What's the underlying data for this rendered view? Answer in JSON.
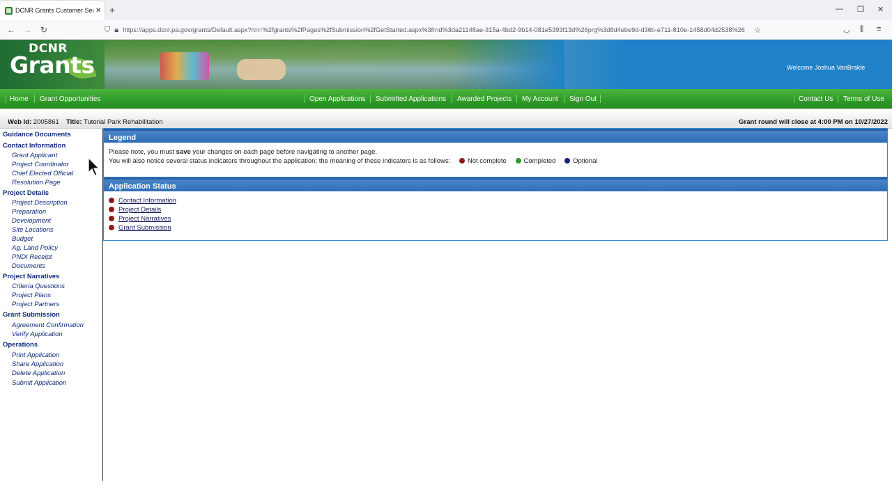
{
  "browser": {
    "tab_title": "DCNR Grants Customer Service",
    "url": "https://apps.dcnr.pa.gov/grants/Default.aspx?rtn=%2fgrants%2fPages%2fSubmission%2fGetStarted.aspx%3frnd%3da21148ae-315a-4bd2-9b14-081e5393f13d%26prg%3d8d4ebe9d-d36b-e711-810e-1458d04d2538%26"
  },
  "banner": {
    "logo_top": "DCNR",
    "logo_main": "Grants",
    "welcome": "Welcome Joshua VanBrakle"
  },
  "menu": {
    "left": [
      "Home",
      "Grant Opportunities"
    ],
    "center": [
      "Open Applications",
      "Submitted Applications",
      "Awarded Projects",
      "My Account",
      "Sign Out"
    ],
    "right": [
      "Contact Us",
      "Terms of Use"
    ]
  },
  "info": {
    "web_id_label": "Web Id:",
    "web_id": "2005861",
    "title_label": "Title:",
    "title": "Tutorial Park Rehabilitation",
    "round_close": "Grant round will close at 4:00 PM on 10/27/2022"
  },
  "sidebar": {
    "guidance": "Guidance Documents",
    "contact_head": "Contact Information",
    "contact_items": [
      "Grant Applicant",
      "Project Coordinator",
      "Chief Elected Official",
      "Resolution Page"
    ],
    "details_head": "Project Details",
    "details_items": [
      "Project Description",
      "Preparation",
      "Development",
      "Site Locations",
      "Budget",
      "Ag. Land Policy",
      "PNDI Receipt",
      "Documents"
    ],
    "narratives_head": "Project Narratives",
    "narratives_items": [
      "Criteria Questions",
      "Project Plans",
      "Project Partners"
    ],
    "submission_head": "Grant Submission",
    "submission_items": [
      "Agreement Confirmation",
      "Verify Application"
    ],
    "operations_head": "Operations",
    "operations_items": [
      "Print Application",
      "Share Application",
      "Delete Application",
      "Submit Application"
    ]
  },
  "legend": {
    "title": "Legend",
    "line1_pre": "Please note, you must ",
    "line1_bold": "save",
    "line1_post": " your changes on each page before navigating to another page.",
    "line2": "You will also notice several status indicators throughout the application; the meaning of these indicators is as follows:",
    "not_complete": "Not complete",
    "completed": "Completed",
    "optional": "Optional"
  },
  "status": {
    "title": "Application Status",
    "items": [
      "Contact Information",
      "Project Details",
      "Project Narratives",
      "Grant Submission"
    ]
  },
  "colors": {
    "not_complete": "#8b1a1a",
    "completed": "#2e9a2e",
    "optional": "#1a237e",
    "menu_green": "#2f9a28",
    "panel_blue": "#2f6db8"
  }
}
